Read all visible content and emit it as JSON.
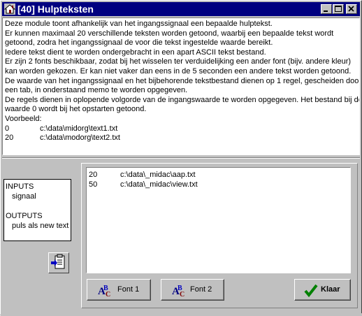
{
  "window": {
    "title": "[40]  Hulpteksten"
  },
  "description": {
    "lines": [
      "Deze module toont afhankelijk van het ingangssignaal een bepaalde hulptekst.",
      "Er kunnen maximaal 20 verschillende teksten worden getoond, waarbij een bepaalde tekst wordt",
      "getoond, zodra het ingangssignaal de voor die tekst ingestelde waarde bereikt.",
      "Iedere tekst dient te worden ondergebracht in een apart ASCII tekst bestand.",
      "Er zijn 2 fonts beschikbaar, zodat bij het wisselen ter verduidelijking een ander font (bijv. andere kleur)",
      "kan worden gekozen. Er kan niet vaker dan eens in de 5 seconden een andere tekst worden getoond.",
      "De waarde van het ingangssignaal en het bijbehorende tekstbestand dienen op 1 regel, gescheiden door",
      "een tab, in onderstaand memo te worden opgegeven.",
      "De regels dienen in oplopende volgorde van de ingangswaarde te worden opgegeven. Het bestand bij de",
      "waarde 0 wordt bij het opstarten getoond.",
      "Voorbeeld:"
    ],
    "examples": [
      {
        "value": "0",
        "file": "c:\\data\\midorg\\text1.txt"
      },
      {
        "value": "20",
        "file": "c:\\data\\modorg\\text2.txt"
      }
    ]
  },
  "io": {
    "inputs_label": "INPUTS",
    "input_signal": "signaal",
    "outputs_label": "OUTPUTS",
    "output_pulse": "puls als new text"
  },
  "memo": {
    "rows": [
      {
        "value": "20",
        "file": "c:\\data\\_midac\\aap.txt"
      },
      {
        "value": "50",
        "file": "c:\\data\\_midac\\view.txt"
      }
    ]
  },
  "buttons": {
    "font1": "Font 1",
    "font2": "Font 2",
    "ok": "Klaar"
  },
  "colors": {
    "titlebar": "#000080",
    "face": "#c0c0c0",
    "check": "#008000"
  }
}
